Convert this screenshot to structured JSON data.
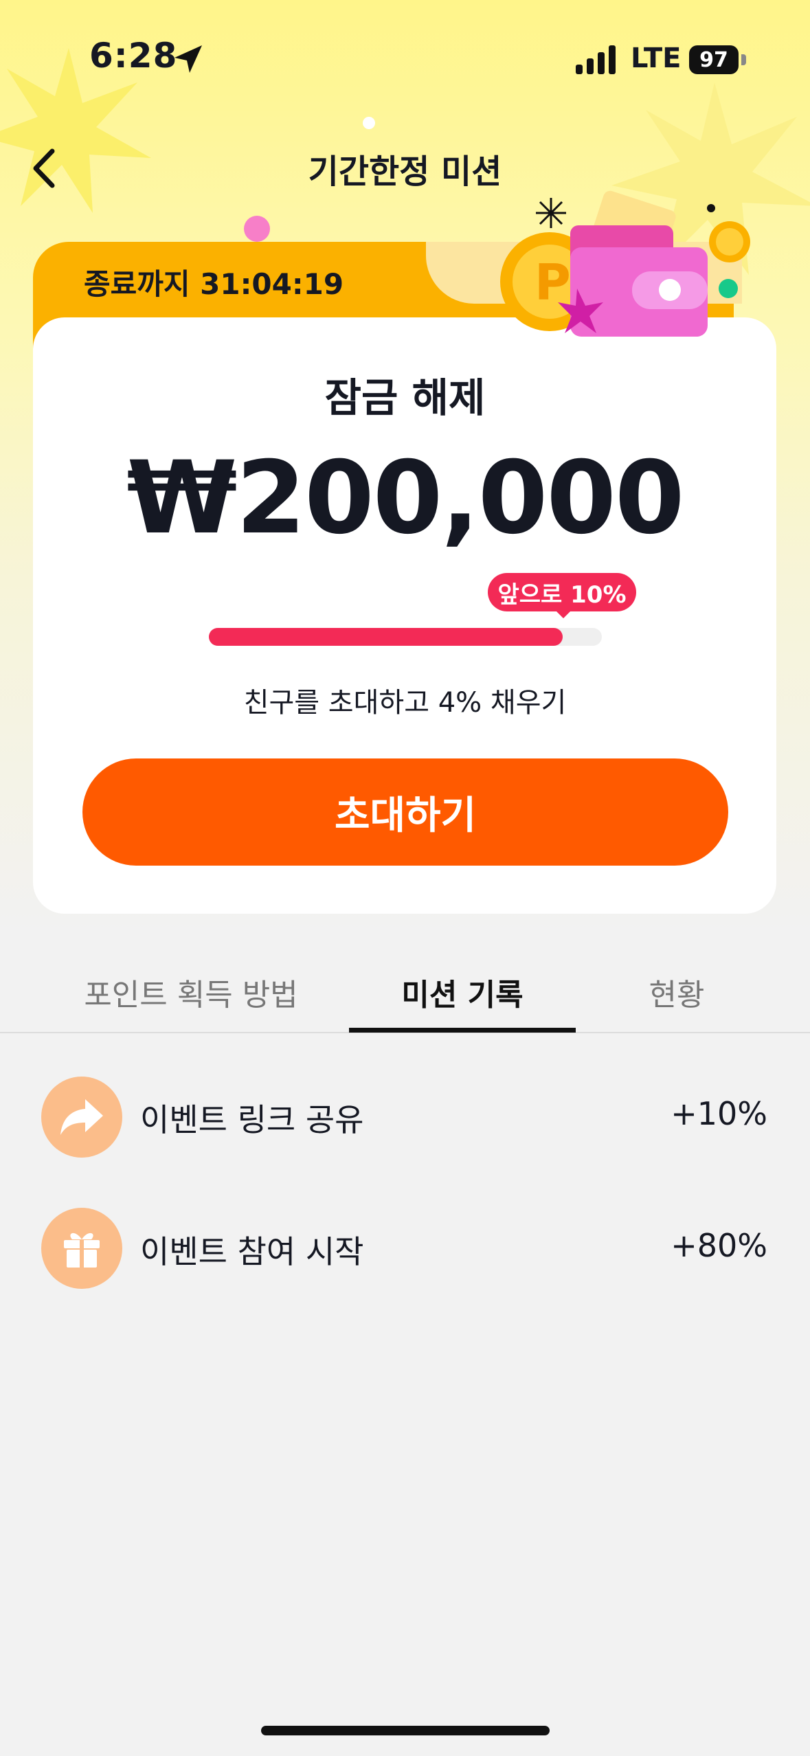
{
  "status_bar": {
    "time": "6:28",
    "network": "LTE",
    "battery": "97"
  },
  "header": {
    "title": "기간한정 미션"
  },
  "mission_card": {
    "timer_text": "종료까지 31:04:19",
    "unlock_label": "잠금 해제",
    "amount": "₩200,000",
    "remaining_badge": "앞으로 10%",
    "progress_fraction": 0.9,
    "hint": "친구를 초대하고 4% 채우기",
    "invite_button": "초대하기"
  },
  "tabs": [
    {
      "label": "포인트 획득 방법",
      "active": false
    },
    {
      "label": "미션 기록",
      "active": true
    },
    {
      "label": "현황",
      "active": false
    }
  ],
  "history": [
    {
      "icon": "share-arrow-icon",
      "label": "이벤트 링크 공유",
      "value": "+10%"
    },
    {
      "icon": "gift-icon",
      "label": "이벤트 참여 시작",
      "value": "+80%"
    }
  ],
  "colors": {
    "accent_orange": "#ff5a00",
    "progress_red": "#f32a56",
    "timer_tab": "#fbb100",
    "icon_circle": "#fbbd8a"
  }
}
